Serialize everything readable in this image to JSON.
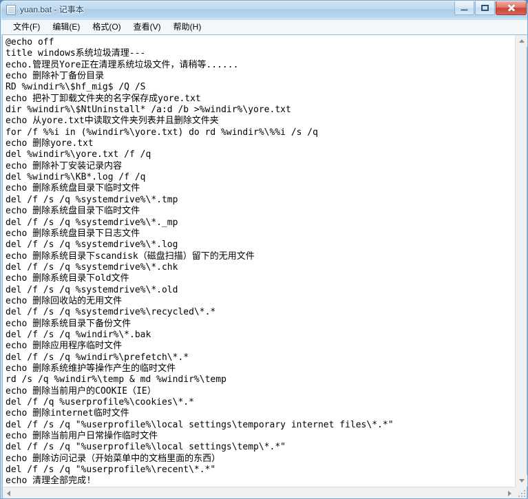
{
  "window": {
    "title": "yuan.bat - 记事本",
    "icon": "notepad-document-icon",
    "frame_color": "#aecfea",
    "titlebar_text_color": "#14395c",
    "close_button_color": "#c9453a"
  },
  "window_controls": {
    "minimize_label": "最小化",
    "maximize_label": "最大化",
    "close_label": "关闭"
  },
  "menu": {
    "items": [
      {
        "label": "文件(F)",
        "name": "menu-file"
      },
      {
        "label": "编辑(E)",
        "name": "menu-edit"
      },
      {
        "label": "格式(O)",
        "name": "menu-format"
      },
      {
        "label": "查看(V)",
        "name": "menu-view"
      },
      {
        "label": "帮助(H)",
        "name": "menu-help"
      }
    ]
  },
  "editor": {
    "font": "monospace",
    "text_color": "#000000",
    "background_color": "#ffffff",
    "lines": [
      "@echo off",
      "title windows系统垃圾清理---",
      "echo.管理员Yore正在清理系统垃圾文件，请稍等......",
      "echo 删除补丁备份目录",
      "RD %windir%\\$hf_mig$ /Q /S",
      "echo 把补丁卸载文件夹的名字保存成yore.txt",
      "dir %windir%\\$NtUninstall* /a:d /b >%windir%\\yore.txt",
      "echo 从yore.txt中读取文件夹列表并且删除文件夹",
      "for /f %%i in (%windir%\\yore.txt) do rd %windir%\\%%i /s /q",
      "echo 删除yore.txt",
      "del %windir%\\yore.txt /f /q",
      "echo 删除补丁安装记录内容",
      "del %windir%\\KB*.log /f /q",
      "echo 删除系统盘目录下临时文件",
      "del /f /s /q %systemdrive%\\*.tmp",
      "echo 删除系统盘目录下临时文件",
      "del /f /s /q %systemdrive%\\*._mp",
      "echo 删除系统盘目录下日志文件",
      "del /f /s /q %systemdrive%\\*.log",
      "echo 删除系统目录下scandisk（磁盘扫描）留下的无用文件",
      "del /f /s /q %systemdrive%\\*.chk",
      "echo 删除系统目录下old文件",
      "del /f /s /q %systemdrive%\\*.old",
      "echo 删除回收站的无用文件",
      "del /f /s /q %systemdrive%\\recycled\\*.*",
      "echo 删除系统目录下备份文件",
      "del /f /s /q %windir%\\*.bak",
      "echo 删除应用程序临时文件",
      "del /f /s /q %windir%\\prefetch\\*.*",
      "echo 删除系统维护等操作产生的临时文件",
      "rd /s /q %windir%\\temp & md %windir%\\temp",
      "echo 删除当前用户的COOKIE（IE）",
      "del /f /q %userprofile%\\cookies\\*.*",
      "echo 删除internet临时文件",
      "del /f /s /q \"%userprofile%\\local settings\\temporary internet files\\*.*\"",
      "echo 删除当前用户日常操作临时文件",
      "del /f /s /q \"%userprofile%\\local settings\\temp\\*.*\"",
      "echo 删除访问记录（开始菜单中的文档里面的东西）",
      "del /f /s /q \"%userprofile%\\recent\\*.*\"",
      "echo 清理全部完成!"
    ]
  },
  "scrollbars": {
    "vertical": {
      "up_arrow": "scroll-up-arrow",
      "down_arrow": "scroll-down-arrow",
      "thumb_visible": false
    },
    "horizontal": {
      "left_arrow": "scroll-left-arrow",
      "right_arrow": "scroll-right-arrow",
      "thumb_visible": false
    },
    "resize_grip": "resize-grip"
  }
}
